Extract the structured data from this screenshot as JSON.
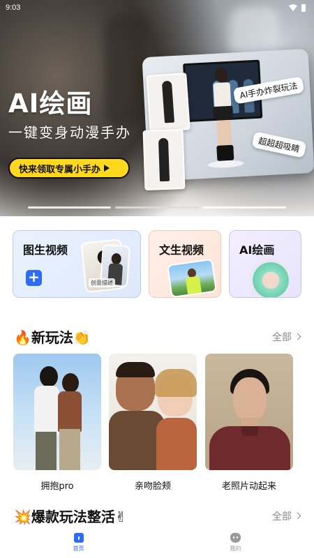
{
  "status_bar": {
    "time": "9:03"
  },
  "banner": {
    "title": "AI绘画",
    "subtitle": "一键变身动漫手办",
    "cta_label": "快来领取专属小手办",
    "tags": [
      "AI手办炸裂玩法",
      "超超超吸睛"
    ]
  },
  "features": [
    {
      "label": "图生视频",
      "chip": "创意描述"
    },
    {
      "label": "文生视频"
    },
    {
      "label": "AI绘画"
    }
  ],
  "sections": {
    "new_play": {
      "title": "新玩法",
      "emoji_left": "🔥",
      "emoji_right": "👏",
      "more": "全部"
    },
    "hot_play": {
      "title": "爆款玩法整活",
      "emoji_left": "💥",
      "emoji_right": "✌",
      "more": "全部"
    }
  },
  "effects": [
    {
      "label": "拥抱pro"
    },
    {
      "label": "亲吻脸颊"
    },
    {
      "label": "老照片动起来"
    }
  ],
  "bottom_nav": [
    {
      "label": "首页",
      "icon": "home-icon",
      "active": true
    },
    {
      "label": "我的",
      "icon": "profile-icon",
      "active": false
    }
  ],
  "colors": {
    "accent": "#2f6cf5",
    "cta": "#ffd81f"
  }
}
